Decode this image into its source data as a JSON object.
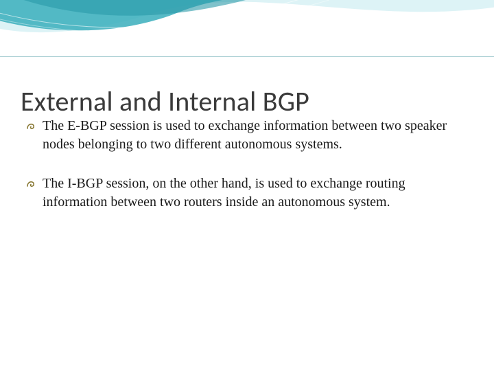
{
  "colors": {
    "wave_fill": "#3aaebc",
    "wave_fill_light": "#a9dfe6",
    "rule": "#5aa1a9",
    "bullet": "#887833",
    "title": "#3a3a3a",
    "body": "#1a1a1a"
  },
  "title": "External and Internal BGP",
  "bullets": [
    {
      "text": "The E-BGP session is used to exchange information between two speaker nodes belonging to two different autonomous systems."
    },
    {
      "text": "The I-BGP session, on the other hand, is used to exchange routing information between two routers inside an autonomous system."
    }
  ]
}
